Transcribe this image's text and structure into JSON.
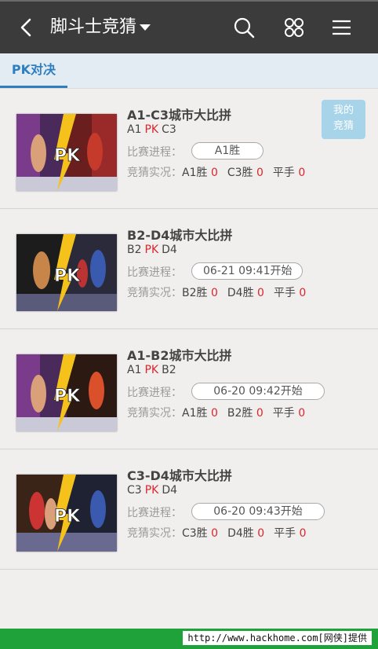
{
  "header": {
    "title": "脚斗士竞猜",
    "back_icon": "back-arrow-icon",
    "search_icon": "search-icon",
    "grid_icon": "grid-icon",
    "menu_icon": "menu-icon"
  },
  "tabs": [
    {
      "label": "PK对决",
      "active": true
    }
  ],
  "my_bet_button": {
    "line1": "我的",
    "line2": "竞猜"
  },
  "labels": {
    "progress": "比赛进程：",
    "bets": "竞猜实况：",
    "pk": "PK"
  },
  "matches": [
    {
      "title": "A1-C3城市大比拼",
      "team_a": "A1",
      "team_b": "C3",
      "status": "A1胜",
      "bet_a_label": "A1胜",
      "bet_a": "0",
      "bet_b_label": "C3胜",
      "bet_b": "0",
      "draw_label": "平手",
      "draw": "0"
    },
    {
      "title": "B2-D4城市大比拼",
      "team_a": "B2",
      "team_b": "D4",
      "status": "06-21 09:41开始",
      "bet_a_label": "B2胜",
      "bet_a": "0",
      "bet_b_label": "D4胜",
      "bet_b": "0",
      "draw_label": "平手",
      "draw": "0"
    },
    {
      "title": "A1-B2城市大比拼",
      "team_a": "A1",
      "team_b": "B2",
      "status": "06-20 09:42开始",
      "bet_a_label": "A1胜",
      "bet_a": "0",
      "bet_b_label": "B2胜",
      "bet_b": "0",
      "draw_label": "平手",
      "draw": "0"
    },
    {
      "title": "C3-D4城市大比拼",
      "team_a": "C3",
      "team_b": "D4",
      "status": "06-20 09:43开始",
      "bet_a_label": "C3胜",
      "bet_a": "0",
      "bet_b_label": "D4胜",
      "bet_b": "0",
      "draw_label": "平手",
      "draw": "0"
    }
  ],
  "watermark": "http://www.hackhome.com[网侠]提供",
  "colors": {
    "topbar": "#3b3b3b",
    "accent": "#2f7fc0",
    "pk_red": "#d9262c",
    "footer_green": "#1ea239"
  }
}
